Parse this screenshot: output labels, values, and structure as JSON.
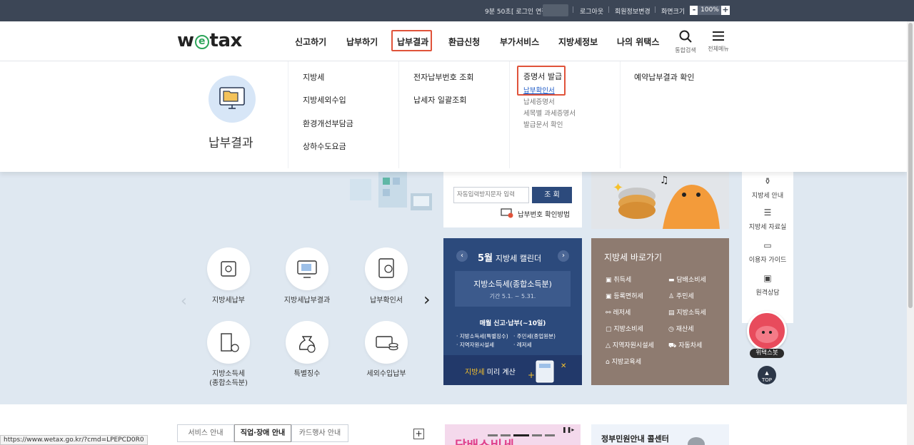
{
  "topbar": {
    "timer": "9분 50초",
    "extend": "[ 로그인 연장",
    "logout": "로그아웃",
    "member_info": "회원정보변경",
    "zoom_label": "화면크기",
    "zoom_minus": "-",
    "zoom_value": "100%",
    "zoom_plus": "+"
  },
  "header": {
    "logo_w": "w",
    "logo_e": "e",
    "logo_tax": "tax",
    "nav": [
      "신고하기",
      "납부하기",
      "납부결과",
      "환급신청",
      "부가서비스",
      "지방세정보",
      "나의 위택스"
    ],
    "search_label": "통합검색",
    "menu_label": "전체메뉴"
  },
  "mega": {
    "category": "납부결과",
    "col1": [
      "지방세",
      "지방세외수입",
      "환경개선부담금",
      "상하수도요금"
    ],
    "col2": [
      "전자납부번호 조회",
      "납세자 일괄조회"
    ],
    "col3_title": "증명서 발급",
    "col3_subs": [
      "납부확인서",
      "납세증명서",
      "세목별 과세증명서",
      "발급문서 확인"
    ],
    "col4": [
      "예약납부결과 확인"
    ]
  },
  "search_box": {
    "captcha_placeholder": "자동입력방지문자 입력",
    "submit": "조 회",
    "help": "납부번호 확인방법"
  },
  "quick_menu": [
    {
      "label": "지방세납부"
    },
    {
      "label": "지방세납부결과"
    },
    {
      "label": "납부확인서"
    },
    {
      "label": "지방소득세\n(종합소득분)"
    },
    {
      "label": "특별징수"
    },
    {
      "label": "세외수입납부"
    }
  ],
  "calendar": {
    "month": "5월",
    "title": "지방세 캘린더",
    "event": "지방소득세(종합소득분)",
    "period": "기간 5.1. ~ 5.31.",
    "notice": "매월 신고·납부(~10일)",
    "items": [
      "· 지방소득세(특별징수)",
      "· 주민세(종업원분)",
      "· 지역자원시설세",
      "· 레저세"
    ],
    "calc_highlight": "지방세",
    "calc_text": "미리 계산"
  },
  "shortcut": {
    "title": "지방세 바로가기",
    "items": [
      "취득세",
      "담배소비세",
      "등록면허세",
      "주민세",
      "레저세",
      "지방소득세",
      "지방소비세",
      "재산세",
      "지역자원시설세",
      "자동차세",
      "지방교육세"
    ]
  },
  "side": {
    "items": [
      "지방세 안내",
      "지방세 자료실",
      "이용자 가이드",
      "원격상담"
    ],
    "bot": "위택스봇",
    "top": "TOP"
  },
  "bottom": {
    "tabs": [
      "서비스 안내",
      "직업·장애 안내",
      "카드행사 안내"
    ],
    "plus": "+",
    "banner_text": "담배소비세",
    "center_title": "정부민원안내 콜센터"
  },
  "status_url": "https://www.wetax.go.kr/?cmd=LPEPCD0R0",
  "colors": {
    "accent_red": "#e0533a",
    "navy": "#2c4a7c",
    "brown": "#8e7b70",
    "logo_green": "#2da55a",
    "link_blue": "#1a57c5"
  }
}
